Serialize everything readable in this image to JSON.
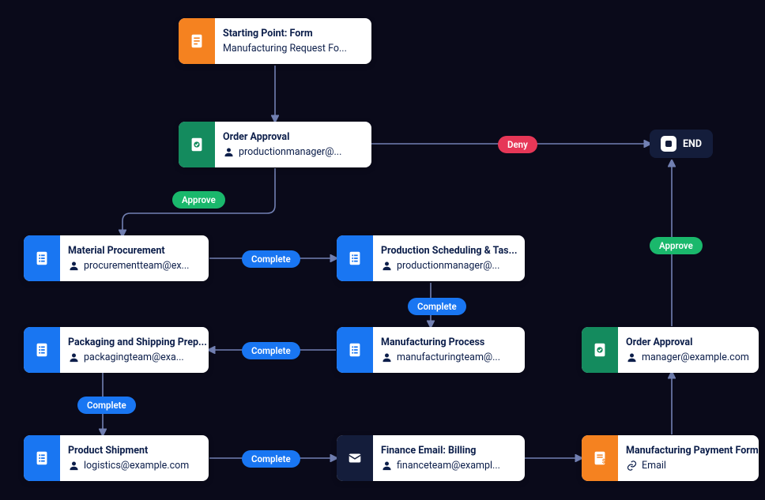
{
  "nodes": {
    "start": {
      "title": "Starting Point: Form",
      "subtitle": "Manufacturing Request Fo..."
    },
    "approval1": {
      "title": "Order Approval",
      "subtitle": "productionmanager@..."
    },
    "material": {
      "title": "Material Procurement",
      "subtitle": "procurementteam@ex..."
    },
    "scheduling": {
      "title": "Production Scheduling & Tas...",
      "subtitle": "productionmanager@..."
    },
    "manufacturing": {
      "title": "Manufacturing Process",
      "subtitle": "manufacturingteam@..."
    },
    "packaging": {
      "title": "Packaging and Shipping Prep...",
      "subtitle": "packagingteam@exa..."
    },
    "shipment": {
      "title": "Product Shipment",
      "subtitle": "logistics@example.com"
    },
    "finance": {
      "title": "Finance Email: Billing",
      "subtitle": "financeteam@exampl..."
    },
    "payment": {
      "title": "Manufacturing Payment Form",
      "subtitle": "Email"
    },
    "approval2": {
      "title": "Order Approval",
      "subtitle": "manager@example.com"
    },
    "end": {
      "label": "END"
    }
  },
  "badges": {
    "approve": "Approve",
    "deny": "Deny",
    "complete": "Complete"
  },
  "colors": {
    "orange": "#f58220",
    "green": "#148b5e",
    "blue": "#1976f2",
    "dark": "#141d3b",
    "approve": "#1ab86c",
    "deny": "#e63757"
  }
}
